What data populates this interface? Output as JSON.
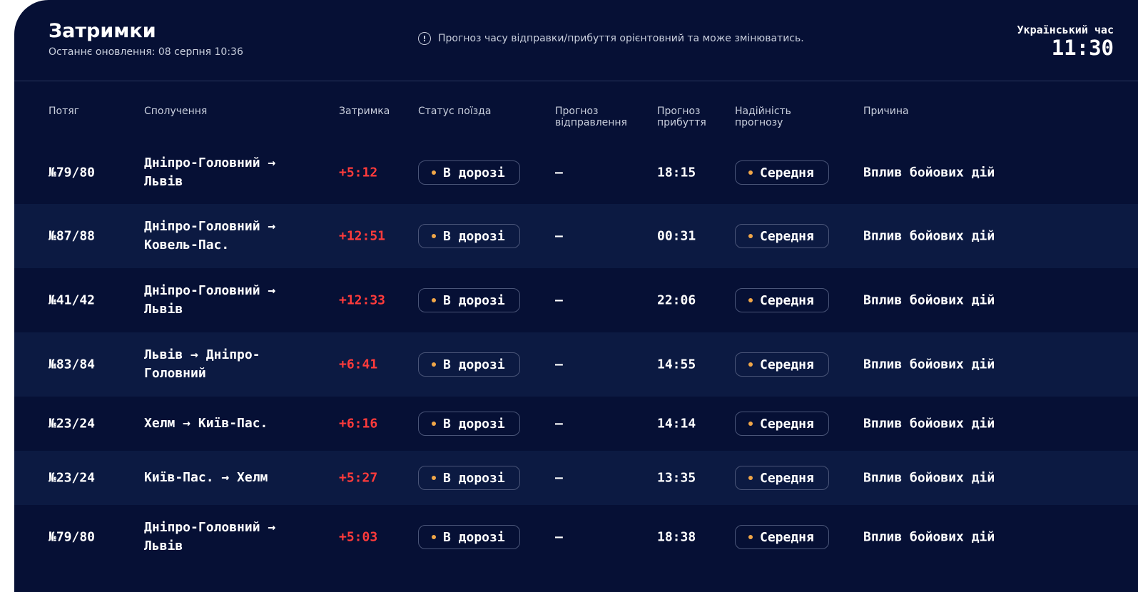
{
  "header": {
    "title": "Затримки",
    "updated": "Останнє оновлення: 08 серпня 10:36",
    "notice": "Прогноз часу відправки/прибуття орієнтовний та може змінюватись.",
    "clock_label": "Український час",
    "clock_time": "11:30"
  },
  "columns": {
    "train": "Потяг",
    "route": "Сполучення",
    "delay": "Затримка",
    "status": "Статус поїзда",
    "departure": "Прогноз відправлення",
    "arrival": "Прогноз прибуття",
    "reliability": "Надійність прогнозу",
    "reason": "Причина"
  },
  "rows": [
    {
      "train": "№79/80",
      "route": "Дніпро-Головний → Львів",
      "delay": "+5:12",
      "status": "В дорозі",
      "departure": "—",
      "arrival": "18:15",
      "reliability": "Середня",
      "reason": "Вплив бойових дій"
    },
    {
      "train": "№87/88",
      "route": "Дніпро-Головний → Ковель-Пас.",
      "delay": "+12:51",
      "status": "В дорозі",
      "departure": "—",
      "arrival": "00:31",
      "reliability": "Середня",
      "reason": "Вплив бойових дій"
    },
    {
      "train": "№41/42",
      "route": "Дніпро-Головний → Львів",
      "delay": "+12:33",
      "status": "В дорозі",
      "departure": "—",
      "arrival": "22:06",
      "reliability": "Середня",
      "reason": "Вплив бойових дій"
    },
    {
      "train": "№83/84",
      "route": "Львів → Дніпро-Головний",
      "delay": "+6:41",
      "status": "В дорозі",
      "departure": "—",
      "arrival": "14:55",
      "reliability": "Середня",
      "reason": "Вплив бойових дій"
    },
    {
      "train": "№23/24",
      "route": "Хелм → Київ-Пас.",
      "delay": "+6:16",
      "status": "В дорозі",
      "departure": "—",
      "arrival": "14:14",
      "reliability": "Середня",
      "reason": "Вплив бойових дій"
    },
    {
      "train": "№23/24",
      "route": "Київ-Пас. → Хелм",
      "delay": "+5:27",
      "status": "В дорозі",
      "departure": "—",
      "arrival": "13:35",
      "reliability": "Середня",
      "reason": "Вплив бойових дій"
    },
    {
      "train": "№79/80",
      "route": "Дніпро-Головний → Львів",
      "delay": "+5:03",
      "status": "В дорозі",
      "departure": "—",
      "arrival": "18:38",
      "reliability": "Середня",
      "reason": "Вплив бойових дій"
    }
  ],
  "colors": {
    "background": "#061035",
    "row_alt": "#0c1a42",
    "delay": "#ff3b3b",
    "status_dot": "#f0a648"
  },
  "icons": {
    "notice": "info-circle-icon",
    "status": "status-dot-icon"
  }
}
